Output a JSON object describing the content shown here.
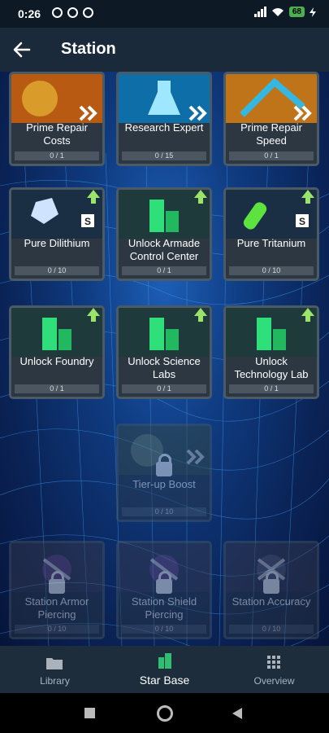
{
  "status_bar": {
    "time": "0:26",
    "battery": "68"
  },
  "app_bar": {
    "title": "Station"
  },
  "cards": [
    {
      "label": "Prime Repair Costs",
      "progress": "0 / 1",
      "art": "chevron"
    },
    {
      "label": "Research Expert",
      "progress": "0 / 15",
      "art": "flask"
    },
    {
      "label": "Prime Repair Speed",
      "progress": "0 / 1",
      "art": "chevron"
    },
    {
      "label": "Pure Dilithium",
      "progress": "0 / 10",
      "art": "dilithium",
      "upgrade": true
    },
    {
      "label": "Unlock Armade Control Center",
      "progress": "0 / 1",
      "art": "building",
      "upgrade": true
    },
    {
      "label": "Pure Tritanium",
      "progress": "0 / 10",
      "art": "tritanium",
      "upgrade": true
    },
    {
      "label": "Unlock Foundry",
      "progress": "0 / 1",
      "art": "building",
      "upgrade": true
    },
    {
      "label": "Unlock Science Labs",
      "progress": "0 / 1",
      "art": "building",
      "upgrade": true
    },
    {
      "label": "Unlock Technology Lab",
      "progress": "0 / 1",
      "art": "building",
      "upgrade": true
    },
    {
      "label": "Tier-up Boost",
      "progress": "0 / 10",
      "art": "chevron",
      "locked": true
    },
    {
      "label": "Station Armor Piercing",
      "progress": "0 / 10",
      "art": "weapon",
      "locked": true
    },
    {
      "label": "Station Shield Piercing",
      "progress": "0 / 10",
      "art": "weapon",
      "locked": true
    },
    {
      "label": "Station Accuracy",
      "progress": "0 / 10",
      "art": "weapon",
      "locked": true
    }
  ],
  "bottom_nav": [
    {
      "label": "Library",
      "icon": "folder-icon"
    },
    {
      "label": "Star Base",
      "icon": "building-icon",
      "active": true
    },
    {
      "label": "Overview",
      "icon": "grid-icon"
    }
  ],
  "colors": {
    "accent": "#2fbf71",
    "card_bg": "#2c3742",
    "upgrade": "#9be36a"
  }
}
